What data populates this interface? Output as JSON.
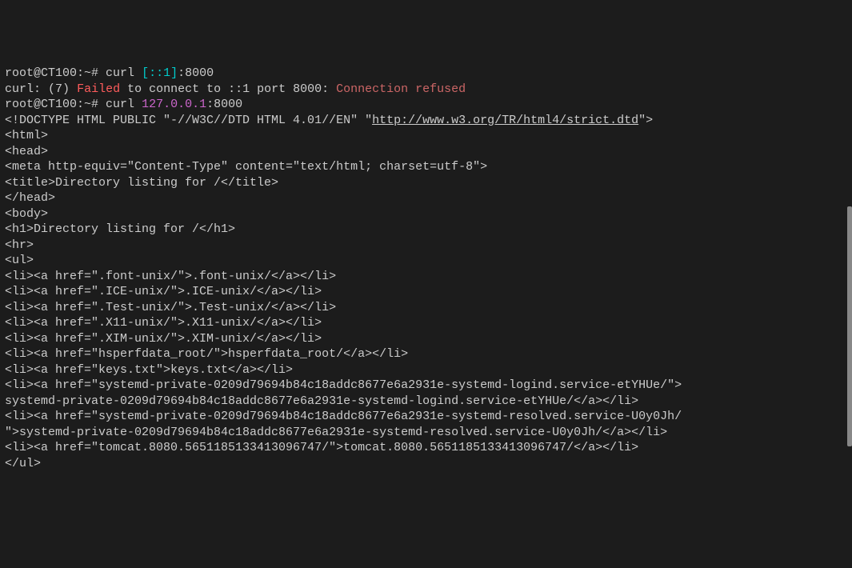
{
  "lines": [
    {
      "segments": [
        {
          "text": "root@CT100",
          "class": "prompt-user"
        },
        {
          "text": ":",
          "class": "gray"
        },
        {
          "text": "~",
          "class": "gray"
        },
        {
          "text": "# curl ",
          "class": "gray"
        },
        {
          "text": "[::1]",
          "class": "cyan"
        },
        {
          "text": ":8000",
          "class": "gray"
        }
      ]
    },
    {
      "segments": [
        {
          "text": "curl: ",
          "class": "gray"
        },
        {
          "text": "(",
          "class": "gray"
        },
        {
          "text": "7",
          "class": "gray"
        },
        {
          "text": ") ",
          "class": "gray"
        },
        {
          "text": "Failed",
          "class": "red"
        },
        {
          "text": " to connect to ::1 port 8000: ",
          "class": "gray"
        },
        {
          "text": "Connection refused",
          "class": "darkred"
        }
      ]
    },
    {
      "segments": [
        {
          "text": "root@CT100",
          "class": "prompt-user"
        },
        {
          "text": ":",
          "class": "gray"
        },
        {
          "text": "~",
          "class": "gray"
        },
        {
          "text": "# curl ",
          "class": "gray"
        },
        {
          "text": "127.0.0.1",
          "class": "magenta"
        },
        {
          "text": ":8000",
          "class": "gray"
        }
      ]
    },
    {
      "segments": [
        {
          "text": "<!DOCTYPE HTML PUBLIC \"-//W3C//DTD HTML 4.01//EN\" \"",
          "class": "gray"
        },
        {
          "text": "http://www.w3.org/TR/html4/strict.dtd",
          "class": "gray underline"
        },
        {
          "text": "\">",
          "class": "gray"
        }
      ]
    },
    {
      "segments": [
        {
          "text": "<html>",
          "class": "gray"
        }
      ]
    },
    {
      "segments": [
        {
          "text": "<head>",
          "class": "gray"
        }
      ]
    },
    {
      "segments": [
        {
          "text": "<meta http-equiv=\"Content-Type\" content=\"text/html; charset=utf-8\">",
          "class": "gray"
        }
      ]
    },
    {
      "segments": [
        {
          "text": "<title>Directory listing for /</title>",
          "class": "gray"
        }
      ]
    },
    {
      "segments": [
        {
          "text": "</head>",
          "class": "gray"
        }
      ]
    },
    {
      "segments": [
        {
          "text": "<body>",
          "class": "gray"
        }
      ]
    },
    {
      "segments": [
        {
          "text": "<h1>Directory listing for /</h1>",
          "class": "gray"
        }
      ]
    },
    {
      "segments": [
        {
          "text": "<hr>",
          "class": "gray"
        }
      ]
    },
    {
      "segments": [
        {
          "text": "<ul>",
          "class": "gray"
        }
      ]
    },
    {
      "segments": [
        {
          "text": "<li><a href=\".font-unix/\">.font-unix/</a></li>",
          "class": "gray"
        }
      ]
    },
    {
      "segments": [
        {
          "text": "<li><a href=\".ICE-unix/\">.ICE-unix/</a></li>",
          "class": "gray"
        }
      ]
    },
    {
      "segments": [
        {
          "text": "<li><a href=\".Test-unix/\">.Test-unix/</a></li>",
          "class": "gray"
        }
      ]
    },
    {
      "segments": [
        {
          "text": "<li><a href=\".X11-unix/\">.X11-unix/</a></li>",
          "class": "gray"
        }
      ]
    },
    {
      "segments": [
        {
          "text": "<li><a href=\".XIM-unix/\">.XIM-unix/</a></li>",
          "class": "gray"
        }
      ]
    },
    {
      "segments": [
        {
          "text": "<li><a href=\"hsperfdata_root/\">hsperfdata_root/</a></li>",
          "class": "gray"
        }
      ]
    },
    {
      "segments": [
        {
          "text": "<li><a href=\"keys.txt\">keys.txt</a></li>",
          "class": "gray"
        }
      ]
    },
    {
      "segments": [
        {
          "text": "<li><a href=\"systemd-private-0209d79694b84c18addc8677e6a2931e-systemd-logind.service-etYHUe/\">",
          "class": "gray"
        }
      ]
    },
    {
      "segments": [
        {
          "text": "systemd-private-0209d79694b84c18addc8677e6a2931e-systemd-logind.service-etYHUe/</a></li>",
          "class": "gray"
        }
      ]
    },
    {
      "segments": [
        {
          "text": "<li><a href=\"systemd-private-0209d79694b84c18addc8677e6a2931e-systemd-resolved.service-U0y0Jh/",
          "class": "gray"
        }
      ]
    },
    {
      "segments": [
        {
          "text": "\">systemd-private-0209d79694b84c18addc8677e6a2931e-systemd-resolved.service-U0y0Jh/</a></li>",
          "class": "gray"
        }
      ]
    },
    {
      "segments": [
        {
          "text": "<li><a href=\"tomcat.8080.5651185133413096747/\">tomcat.8080.5651185133413096747/</a></li>",
          "class": "gray"
        }
      ]
    },
    {
      "segments": [
        {
          "text": "</ul>",
          "class": "gray"
        }
      ]
    }
  ]
}
